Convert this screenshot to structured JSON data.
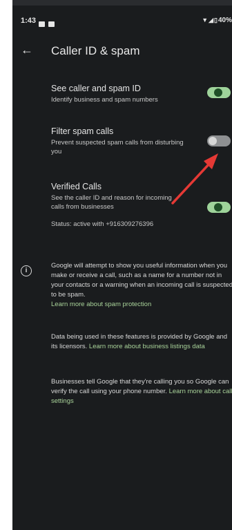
{
  "status_bar": {
    "time": "1:43",
    "battery": "40%"
  },
  "app_bar": {
    "title": "Caller ID & spam"
  },
  "settings": [
    {
      "title": "See caller and spam ID",
      "subtitle": "Identify business and spam numbers",
      "enabled": true
    },
    {
      "title": "Filter spam calls",
      "subtitle": "Prevent suspected spam calls from disturbing you",
      "enabled": false
    },
    {
      "title": "Verified Calls",
      "subtitle": "See the caller ID and reason for incoming calls from businesses",
      "status": "Status: active with +916309276396",
      "enabled": true
    }
  ],
  "info": {
    "para1": "Google will attempt to show you useful information when you make or receive a call, such as a name for a number not in your contacts or a warning when an incoming call is suspected to be spam.",
    "link1": "Learn more about spam protection",
    "para2": "Data being used in these features is provided by Google and its licensors.",
    "link2": "Learn more about business listings data",
    "para3": "Businesses tell Google that they're calling you so Google can verify the call using your phone number.",
    "link3": "Learn more about call settings"
  },
  "colors": {
    "background": "#1a1c1e",
    "toggle_on_track": "#9ed39a",
    "toggle_off_track": "#8e9092",
    "link": "#a9d39a",
    "annotation_arrow": "#e53935"
  }
}
